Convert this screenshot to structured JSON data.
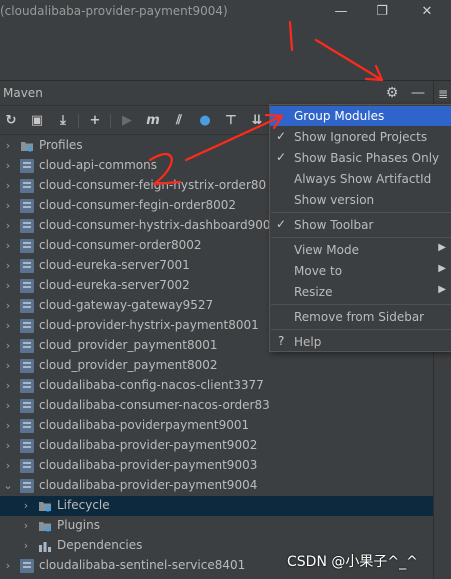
{
  "window": {
    "title": "(cloudalibaba-provider-payment9004)",
    "minimize_icon": "minimize-icon",
    "restore_icon": "restore-icon",
    "close_icon": "close-icon"
  },
  "tool_window": {
    "title": "Maven",
    "settings_icon": "gear-icon",
    "hide_icon": "minimize-icon",
    "side_icon": "database-icon"
  },
  "toolbar": {
    "icons": [
      "reload-icon",
      "add-project-icon",
      "download-icon",
      "add-icon",
      "run-icon",
      "execute-goal-icon",
      "skip-tests-icon",
      "offline-icon",
      "show-dependencies-icon",
      "collapse-icon"
    ]
  },
  "tree": [
    {
      "label": "Profiles",
      "level": 0,
      "expanded": false,
      "icon": "profiles-folder-icon"
    },
    {
      "label": "cloud-api-commons",
      "level": 0,
      "expanded": false,
      "icon": "maven-module-icon"
    },
    {
      "label": "cloud-consumer-feign-hystrix-order80",
      "level": 0,
      "expanded": false,
      "icon": "maven-module-icon"
    },
    {
      "label": "cloud-consumer-fegin-order8002",
      "level": 0,
      "expanded": false,
      "icon": "maven-module-icon"
    },
    {
      "label": "cloud-consumer-hystrix-dashboard9001",
      "level": 0,
      "expanded": false,
      "icon": "maven-module-icon"
    },
    {
      "label": "cloud-consumer-order8002",
      "level": 0,
      "expanded": false,
      "icon": "maven-module-icon"
    },
    {
      "label": "cloud-eureka-server7001",
      "level": 0,
      "expanded": false,
      "icon": "maven-module-icon"
    },
    {
      "label": "cloud-eureka-server7002",
      "level": 0,
      "expanded": false,
      "icon": "maven-module-icon"
    },
    {
      "label": "cloud-gateway-gateway9527",
      "level": 0,
      "expanded": false,
      "icon": "maven-module-icon"
    },
    {
      "label": "cloud-provider-hystrix-payment8001",
      "level": 0,
      "expanded": false,
      "icon": "maven-module-icon"
    },
    {
      "label": "cloud_provider_payment8001",
      "level": 0,
      "expanded": false,
      "icon": "maven-module-icon"
    },
    {
      "label": "cloud_provider_payment8002",
      "level": 0,
      "expanded": false,
      "icon": "maven-module-icon"
    },
    {
      "label": "cloudalibaba-config-nacos-client3377",
      "level": 0,
      "expanded": false,
      "icon": "maven-module-icon"
    },
    {
      "label": "cloudalibaba-consumer-nacos-order83",
      "level": 0,
      "expanded": false,
      "icon": "maven-module-icon"
    },
    {
      "label": "cloudalibaba-poviderpayment9001",
      "level": 0,
      "expanded": false,
      "icon": "maven-module-icon"
    },
    {
      "label": "cloudalibaba-provider-payment9002",
      "level": 0,
      "expanded": false,
      "icon": "maven-module-icon"
    },
    {
      "label": "cloudalibaba-provider-payment9003",
      "level": 0,
      "expanded": false,
      "icon": "maven-module-icon"
    },
    {
      "label": "cloudalibaba-provider-payment9004",
      "level": 0,
      "expanded": true,
      "icon": "maven-module-icon"
    },
    {
      "label": "Lifecycle",
      "level": 1,
      "expanded": false,
      "icon": "lifecycle-folder-icon",
      "selected": true
    },
    {
      "label": "Plugins",
      "level": 1,
      "expanded": false,
      "icon": "plugins-folder-icon"
    },
    {
      "label": "Dependencies",
      "level": 1,
      "expanded": false,
      "icon": "dependencies-icon"
    },
    {
      "label": "cloudalibaba-sentinel-service8401",
      "level": 0,
      "expanded": false,
      "icon": "maven-module-icon"
    }
  ],
  "menu": {
    "items": [
      {
        "label": "Group Modules",
        "checked": false,
        "submenu": false,
        "active": true
      },
      {
        "label": "Show Ignored Projects",
        "checked": true,
        "submenu": false
      },
      {
        "label": "Show Basic Phases Only",
        "checked": true,
        "submenu": false
      },
      {
        "label": "Always Show ArtifactId",
        "checked": false,
        "submenu": false
      },
      {
        "label": "Show version",
        "checked": false,
        "submenu": false
      },
      {
        "label": "Show Toolbar",
        "checked": true,
        "submenu": false,
        "sep_before": true
      },
      {
        "label": "View Mode",
        "checked": false,
        "submenu": true,
        "sep_before": true
      },
      {
        "label": "Move to",
        "checked": false,
        "submenu": true
      },
      {
        "label": "Resize",
        "checked": false,
        "submenu": true
      },
      {
        "label": "Remove from Sidebar",
        "checked": false,
        "submenu": false,
        "sep_before": true
      },
      {
        "label": "Help",
        "checked": false,
        "submenu": false,
        "sep_before": true,
        "prefix": "?"
      }
    ]
  },
  "watermark": "CSDN @小果子^_^",
  "colors": {
    "background": "#3c3f41",
    "selection": "#0d293e",
    "menu_highlight": "#2f65ca",
    "annotation": "#ff2a1a",
    "text": "#bbbbbb"
  }
}
